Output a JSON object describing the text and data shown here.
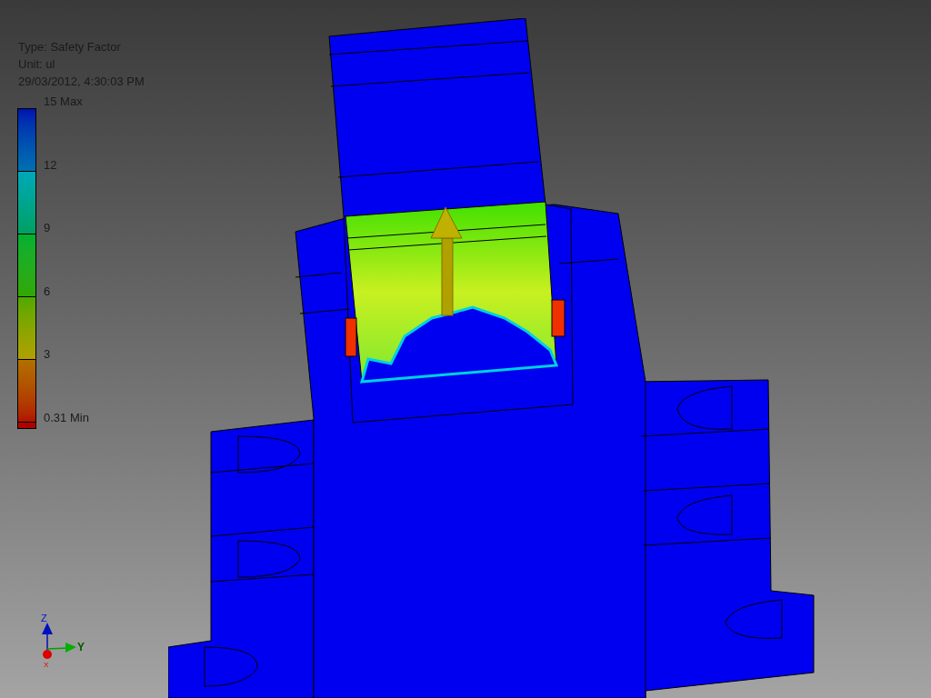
{
  "legend": {
    "info": [
      "Type: Safety Factor",
      "Unit: ul",
      "29/03/2012, 4:30:03 PM"
    ],
    "scale": [
      "15 Max",
      "12",
      "9",
      "6",
      "3",
      "0.31 Min"
    ]
  },
  "axis_triad": {
    "labels": [
      "Z",
      "Y",
      "X"
    ]
  }
}
